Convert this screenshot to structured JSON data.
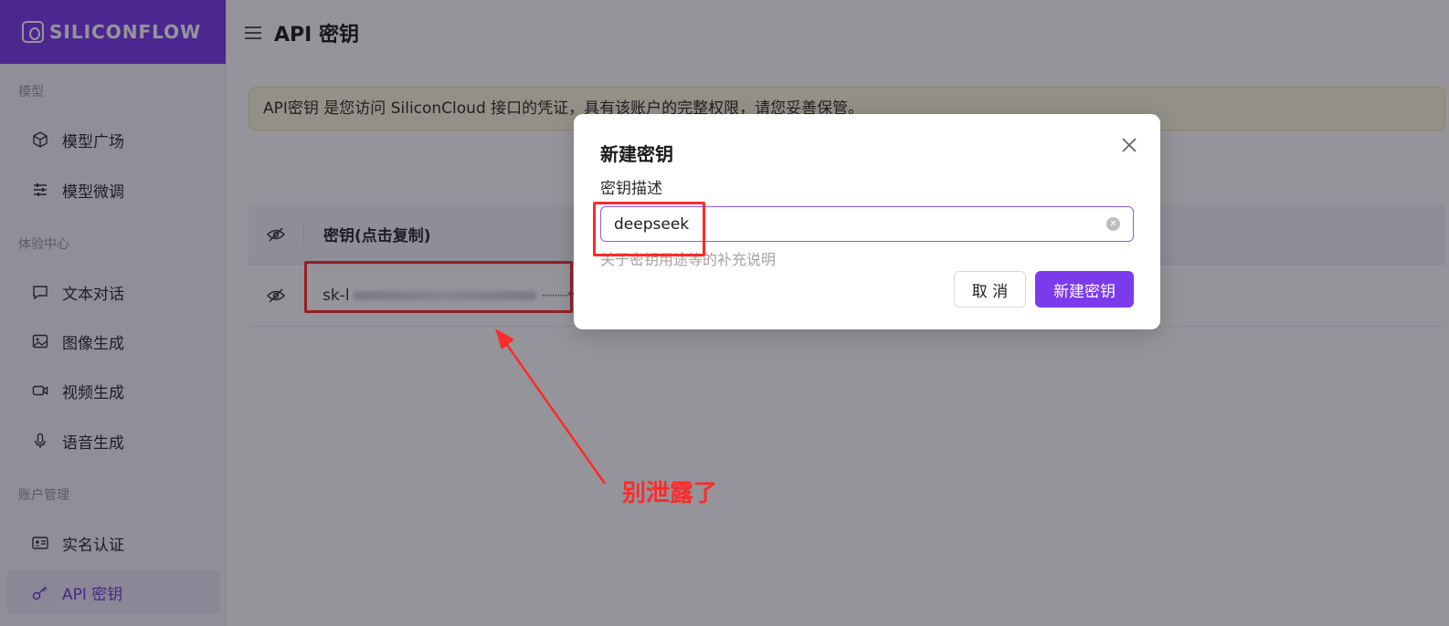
{
  "sidebar": {
    "logo_text": "SILICONFLOW",
    "sections": [
      {
        "title": "模型",
        "items": [
          {
            "label": "模型广场",
            "icon": "cube-icon"
          },
          {
            "label": "模型微调",
            "icon": "sliders-icon"
          }
        ]
      },
      {
        "title": "体验中心",
        "items": [
          {
            "label": "文本对话",
            "icon": "chat-icon"
          },
          {
            "label": "图像生成",
            "icon": "image-icon"
          },
          {
            "label": "视频生成",
            "icon": "video-icon"
          },
          {
            "label": "语音生成",
            "icon": "mic-icon"
          }
        ]
      },
      {
        "title": "账户管理",
        "items": [
          {
            "label": "实名认证",
            "icon": "id-card-icon"
          },
          {
            "label": "API 密钥",
            "icon": "key-icon",
            "active": true
          }
        ]
      }
    ]
  },
  "header": {
    "title": "API 密钥"
  },
  "alert": {
    "text": "API密钥 是您访问 SiliconCloud 接口的凭证，具有该账户的完整权限，请您妥善保管。"
  },
  "table": {
    "header_label": "密钥(点击复制)",
    "row": {
      "key_prefix": "sk-l",
      "key_tail": "··········**"
    }
  },
  "modal": {
    "title": "新建密钥",
    "field_label": "密钥描述",
    "input_value": "deepseek",
    "help_text": "关于密钥用途等的补充说明",
    "cancel_label": "取 消",
    "create_label": "新建密钥"
  },
  "annotation": {
    "text": "别泄露了",
    "color": "#ff2a2a"
  },
  "colors": {
    "accent": "#7c3aed",
    "alert_bg": "#fbf7dc"
  }
}
